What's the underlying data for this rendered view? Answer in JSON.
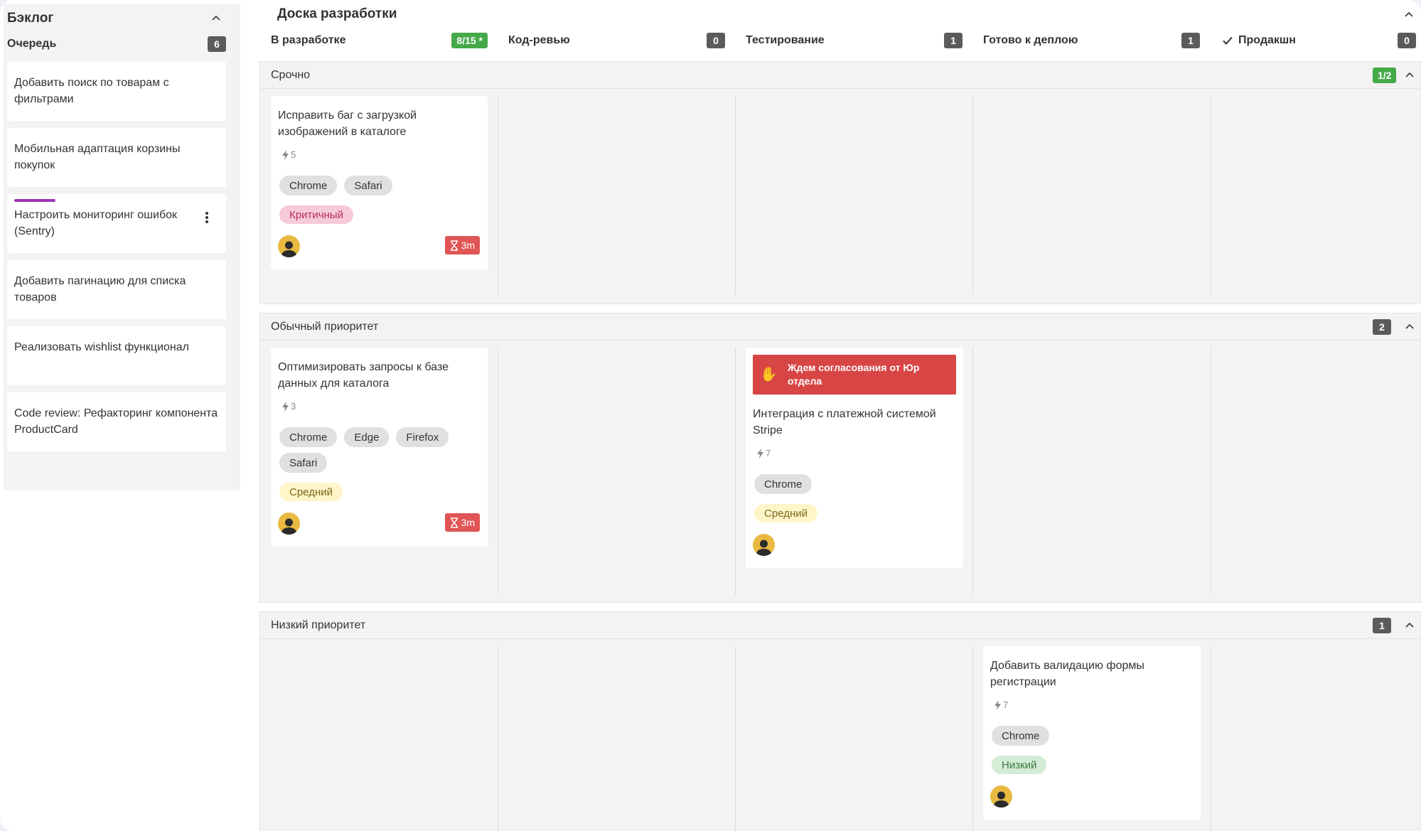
{
  "backlog": {
    "title": "Бэклог",
    "queue_label": "Очередь",
    "queue_count": "6",
    "items": [
      {
        "title": "Добавить поиск по товарам с фильтрами"
      },
      {
        "title": "Мобильная адаптация корзины покупок"
      },
      {
        "title": "Настроить мониторинг ошибок (Sentry)"
      },
      {
        "title": "Добавить пагинацию для списка товаров"
      },
      {
        "title": "Реализовать wishlist функционал"
      },
      {
        "title": "Code review: Рефакторинг компонента ProductCard"
      }
    ]
  },
  "board": {
    "title": "Доска разработки",
    "columns": [
      {
        "name": "В разработке",
        "count": "8/15 *"
      },
      {
        "name": "Код-ревью",
        "count": "0"
      },
      {
        "name": "Тестирование",
        "count": "1"
      },
      {
        "name": "Готово к деплою",
        "count": "1"
      },
      {
        "name": "Продакшн",
        "count": "0"
      }
    ],
    "lanes": [
      {
        "name": "Срочно",
        "count": "1/2"
      },
      {
        "name": "Обычный приоритет",
        "count": "2"
      },
      {
        "name": "Низкий приоритет",
        "count": "1"
      }
    ],
    "cards": {
      "bug": {
        "title": "Исправить баг с загрузкой изображений в каталоге",
        "points": "5",
        "tags": [
          "Chrome",
          "Safari"
        ],
        "priority": "Критичный",
        "timer": "3m"
      },
      "db": {
        "title": "Оптимизировать запросы к базе данных для каталога",
        "points": "3",
        "tags": [
          "Chrome",
          "Edge",
          "Firefox",
          "Safari"
        ],
        "priority": "Средний",
        "timer": "3m"
      },
      "stripe": {
        "blocker": "Ждем согласования от Юр отдела",
        "title": "Интеграция с платежной системой Stripe",
        "points": "7",
        "tags": [
          "Chrome"
        ],
        "priority": "Средний"
      },
      "form": {
        "title": "Добавить валидацию формы регистрации",
        "points": "7",
        "tags": [
          "Chrome"
        ],
        "priority": "Низкий"
      }
    }
  },
  "icons": {
    "collapse": "chevron-up-icon",
    "points": "bolt-icon",
    "timer": "hourglass-icon",
    "done": "checkmark-icon",
    "blocker": "raised-hand-icon",
    "more": "kebab-menu-icon"
  },
  "colors": {
    "accent_purple": "#9c36b5",
    "badge_green": "#45a94a",
    "badge_dark": "#5b5b5b",
    "blocker_red": "#d84545",
    "timer_red": "#e05555"
  }
}
